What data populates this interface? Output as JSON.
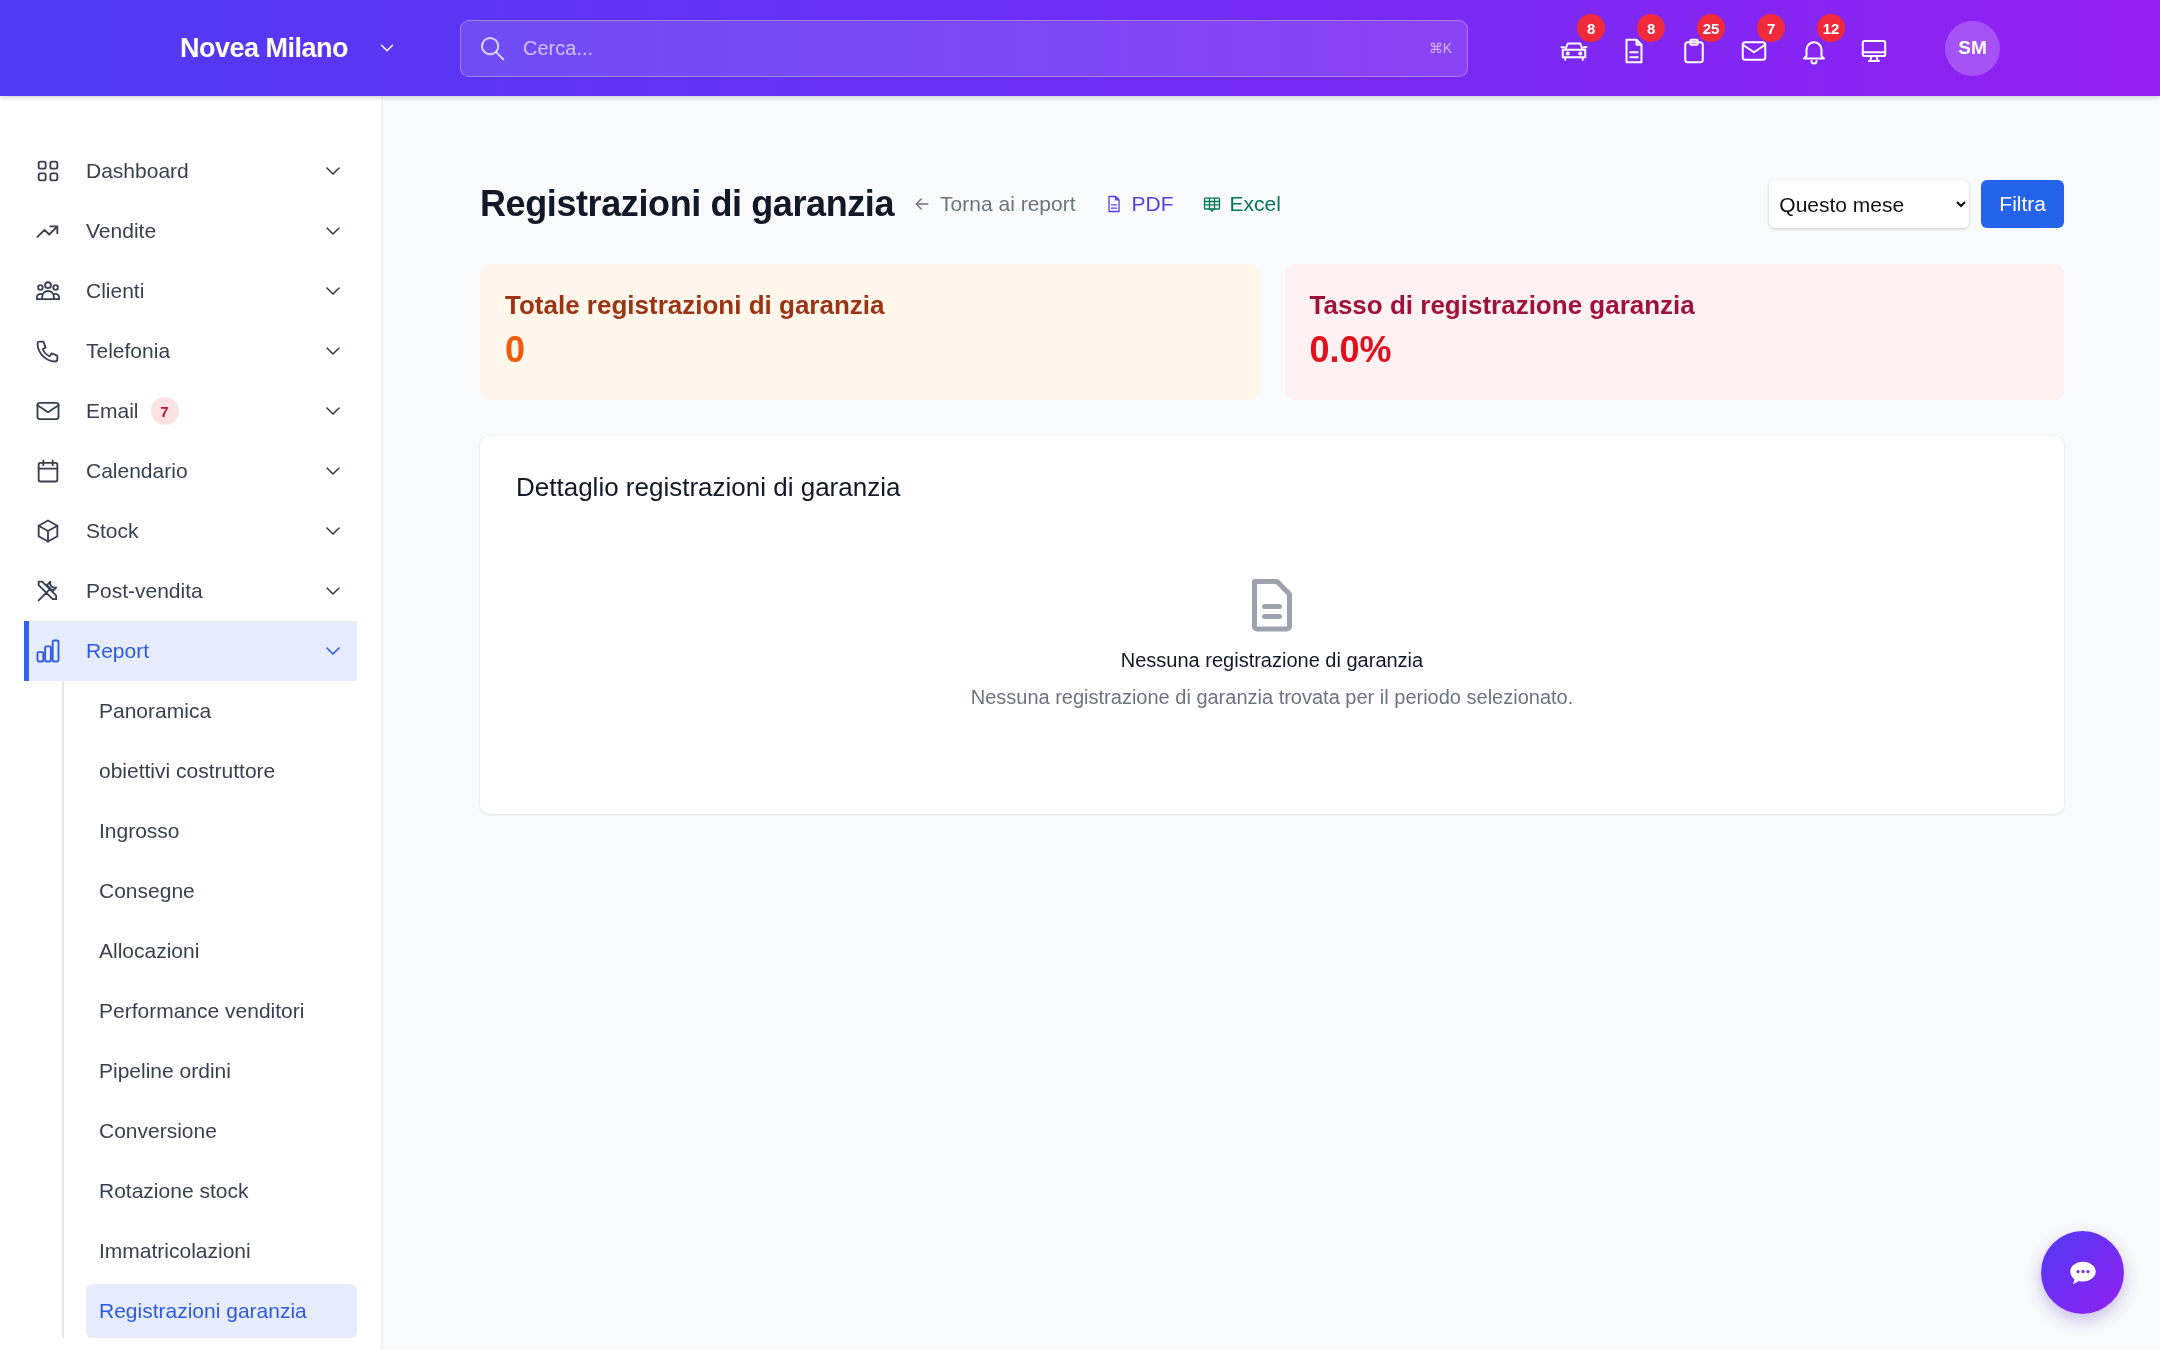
{
  "header": {
    "brand": "Novea Milano",
    "search": {
      "placeholder": "Cerca...",
      "shortcut": "⌘K"
    },
    "badges": [
      {
        "count": "8"
      },
      {
        "count": "8"
      },
      {
        "count": "25"
      },
      {
        "count": "7"
      },
      {
        "count": "12"
      }
    ],
    "avatar": "SM"
  },
  "sidebar": {
    "items": [
      {
        "label": "Dashboard",
        "selected": false
      },
      {
        "label": "Vendite",
        "selected": false
      },
      {
        "label": "Clienti",
        "selected": false
      },
      {
        "label": "Telefonia",
        "selected": false
      },
      {
        "label": "Email",
        "selected": false,
        "badge": "7"
      },
      {
        "label": "Calendario",
        "selected": false
      },
      {
        "label": "Stock",
        "selected": false
      },
      {
        "label": "Post-vendita",
        "selected": false
      },
      {
        "label": "Report",
        "selected": true,
        "children": [
          {
            "label": "Panoramica",
            "selected": false
          },
          {
            "label": "obiettivi costruttore",
            "selected": false
          },
          {
            "label": "Ingrosso",
            "selected": false
          },
          {
            "label": "Consegne",
            "selected": false
          },
          {
            "label": "Allocazioni",
            "selected": false
          },
          {
            "label": "Performance venditori",
            "selected": false
          },
          {
            "label": "Pipeline ordini",
            "selected": false
          },
          {
            "label": "Conversione",
            "selected": false
          },
          {
            "label": "Rotazione stock",
            "selected": false
          },
          {
            "label": "Immatricolazioni",
            "selected": false
          },
          {
            "label": "Registrazioni garanzia",
            "selected": true
          }
        ]
      }
    ]
  },
  "page": {
    "title": "Registrazioni di garanzia",
    "back_link": "Torna ai report",
    "exports": [
      {
        "kind": "pdf",
        "label": "PDF"
      },
      {
        "kind": "excel",
        "label": "Excel"
      }
    ],
    "period": "Questo mese",
    "filter_button": "Filtra",
    "stats": [
      {
        "kind": "warning",
        "label": "Totale registrazioni di garanzia",
        "value": "0"
      },
      {
        "kind": "danger",
        "label": "Tasso di registrazione garanzia",
        "value": "0.0%"
      }
    ],
    "detail": {
      "title": "Dettaglio registrazioni di garanzia",
      "empty_title": "Nessuna registrazione di garanzia",
      "empty_text": "Nessuna registrazione di garanzia trovata per il periodo selezionato."
    }
  }
}
